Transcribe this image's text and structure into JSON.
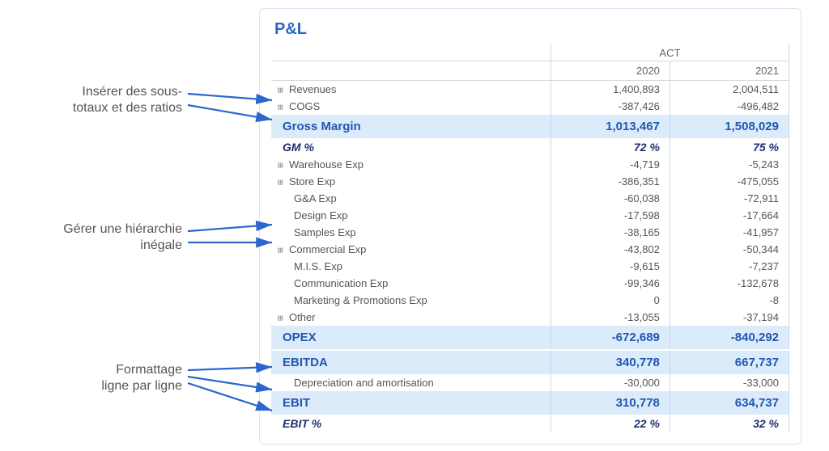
{
  "annots": {
    "a1_line1": "Insérer des sous-",
    "a1_line2": "totaux et des ratios",
    "a2_line1": "Gérer une hiérarchie",
    "a2_line2": "inégale",
    "a3_line1": "Formattage",
    "a3_line2": "ligne par ligne"
  },
  "card": {
    "title": "P&L",
    "header_group": "ACT",
    "year_a": "2020",
    "year_b": "2021"
  },
  "rows": {
    "revenues": {
      "label": "Revenues",
      "a": "1,400,893",
      "b": "2,004,511"
    },
    "cogs": {
      "label": "COGS",
      "a": "-387,426",
      "b": "-496,482"
    },
    "gross": {
      "label": "Gross Margin",
      "a": "1,013,467",
      "b": "1,508,029"
    },
    "gm_pct": {
      "label": "GM %",
      "a": "72 %",
      "b": "75 %"
    },
    "warehouse": {
      "label": "Warehouse Exp",
      "a": "-4,719",
      "b": "-5,243"
    },
    "store": {
      "label": "Store Exp",
      "a": "-386,351",
      "b": "-475,055"
    },
    "ga": {
      "label": "G&A Exp",
      "a": "-60,038",
      "b": "-72,911"
    },
    "design": {
      "label": "Design Exp",
      "a": "-17,598",
      "b": "-17,664"
    },
    "samples": {
      "label": "Samples Exp",
      "a": "-38,165",
      "b": "-41,957"
    },
    "commercial": {
      "label": "Commercial Exp",
      "a": "-43,802",
      "b": "-50,344"
    },
    "mis": {
      "label": "M.I.S. Exp",
      "a": "-9,615",
      "b": "-7,237"
    },
    "comm": {
      "label": "Communication Exp",
      "a": "-99,346",
      "b": "-132,678"
    },
    "mktg": {
      "label": "Marketing & Promotions Exp",
      "a": "0",
      "b": "-8"
    },
    "other": {
      "label": "Other",
      "a": "-13,055",
      "b": "-37,194"
    },
    "opex": {
      "label": "OPEX",
      "a": "-672,689",
      "b": "-840,292"
    },
    "ebitda": {
      "label": "EBITDA",
      "a": "340,778",
      "b": "667,737"
    },
    "dep": {
      "label": "Depreciation and amortisation",
      "a": "-30,000",
      "b": "-33,000"
    },
    "ebit": {
      "label": "EBIT",
      "a": "310,778",
      "b": "634,737"
    },
    "ebit_pct": {
      "label": "EBIT %",
      "a": "22 %",
      "b": "32 %"
    }
  },
  "icons": {
    "expand": "⊞"
  },
  "colors": {
    "accent": "#2a66cc",
    "highlight_bg": "#dcebfa",
    "arrow": "#2a66cc",
    "navy": "#20306e"
  }
}
